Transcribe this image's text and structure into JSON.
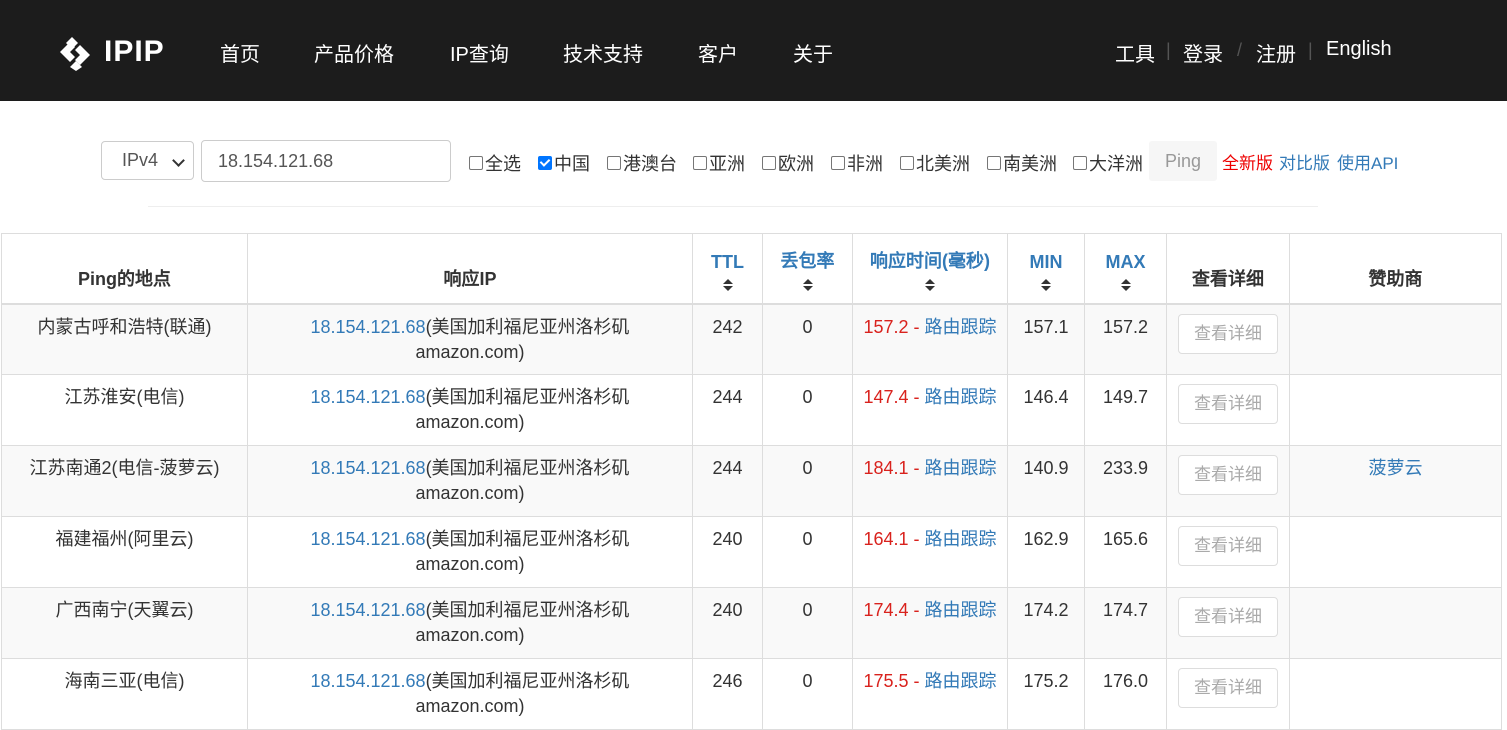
{
  "header": {
    "logo_text": "IPIP",
    "nav": [
      "首页",
      "产品价格",
      "IP查询",
      "技术支持",
      "客户",
      "关于"
    ],
    "right": {
      "tools": "工具",
      "login": "登录",
      "register": "注册",
      "english": "English"
    }
  },
  "search": {
    "ip_version": "IPv4",
    "ip_value": "18.154.121.68",
    "regions": [
      {
        "label": "全选",
        "checked": false
      },
      {
        "label": "中国",
        "checked": true
      },
      {
        "label": "港澳台",
        "checked": false
      },
      {
        "label": "亚洲",
        "checked": false
      },
      {
        "label": "欧洲",
        "checked": false
      },
      {
        "label": "非洲",
        "checked": false
      },
      {
        "label": "北美洲",
        "checked": false
      },
      {
        "label": "南美洲",
        "checked": false
      },
      {
        "label": "大洋洲",
        "checked": false
      }
    ],
    "ping_button": "Ping",
    "new_version": "全新版",
    "compare_version": "对比版",
    "use_api": "使用API"
  },
  "table": {
    "headers": {
      "location": "Ping的地点",
      "ip": "响应IP",
      "ttl": "TTL",
      "loss": "丢包率",
      "rtt": "响应时间(毫秒)",
      "min": "MIN",
      "max": "MAX",
      "detail": "查看详细",
      "sponsor": "赞助商"
    },
    "rows": [
      {
        "location": "内蒙古呼和浩特(联通)",
        "ip": "18.154.121.68",
        "ip_info": "(美国加利福尼亚州洛杉矶",
        "ip_info2": "amazon.com)",
        "ttl": "242",
        "loss": "0",
        "rtt": "157.2",
        "dash": " - ",
        "trace": "路由跟踪",
        "min": "157.1",
        "max": "157.2",
        "detail": "查看详细",
        "sponsor": ""
      },
      {
        "location": "江苏淮安(电信)",
        "ip": "18.154.121.68",
        "ip_info": "(美国加利福尼亚州洛杉矶",
        "ip_info2": "amazon.com)",
        "ttl": "244",
        "loss": "0",
        "rtt": "147.4",
        "dash": " - ",
        "trace": "路由跟踪",
        "min": "146.4",
        "max": "149.7",
        "detail": "查看详细",
        "sponsor": ""
      },
      {
        "location": "江苏南通2(电信-菠萝云)",
        "ip": "18.154.121.68",
        "ip_info": "(美国加利福尼亚州洛杉矶",
        "ip_info2": "amazon.com)",
        "ttl": "244",
        "loss": "0",
        "rtt": "184.1",
        "dash": " - ",
        "trace": "路由跟踪",
        "min": "140.9",
        "max": "233.9",
        "detail": "查看详细",
        "sponsor": "菠萝云"
      },
      {
        "location": "福建福州(阿里云)",
        "ip": "18.154.121.68",
        "ip_info": "(美国加利福尼亚州洛杉矶",
        "ip_info2": "amazon.com)",
        "ttl": "240",
        "loss": "0",
        "rtt": "164.1",
        "dash": " - ",
        "trace": "路由跟踪",
        "min": "162.9",
        "max": "165.6",
        "detail": "查看详细",
        "sponsor": ""
      },
      {
        "location": "广西南宁(天翼云)",
        "ip": "18.154.121.68",
        "ip_info": "(美国加利福尼亚州洛杉矶",
        "ip_info2": "amazon.com)",
        "ttl": "240",
        "loss": "0",
        "rtt": "174.4",
        "dash": " - ",
        "trace": "路由跟踪",
        "min": "174.2",
        "max": "174.7",
        "detail": "查看详细",
        "sponsor": ""
      },
      {
        "location": "海南三亚(电信)",
        "ip": "18.154.121.68",
        "ip_info": "(美国加利福尼亚州洛杉矶",
        "ip_info2": "amazon.com)",
        "ttl": "246",
        "loss": "0",
        "rtt": "175.5",
        "dash": " - ",
        "trace": "路由跟踪",
        "min": "175.2",
        "max": "176.0",
        "detail": "查看详细",
        "sponsor": ""
      }
    ]
  }
}
